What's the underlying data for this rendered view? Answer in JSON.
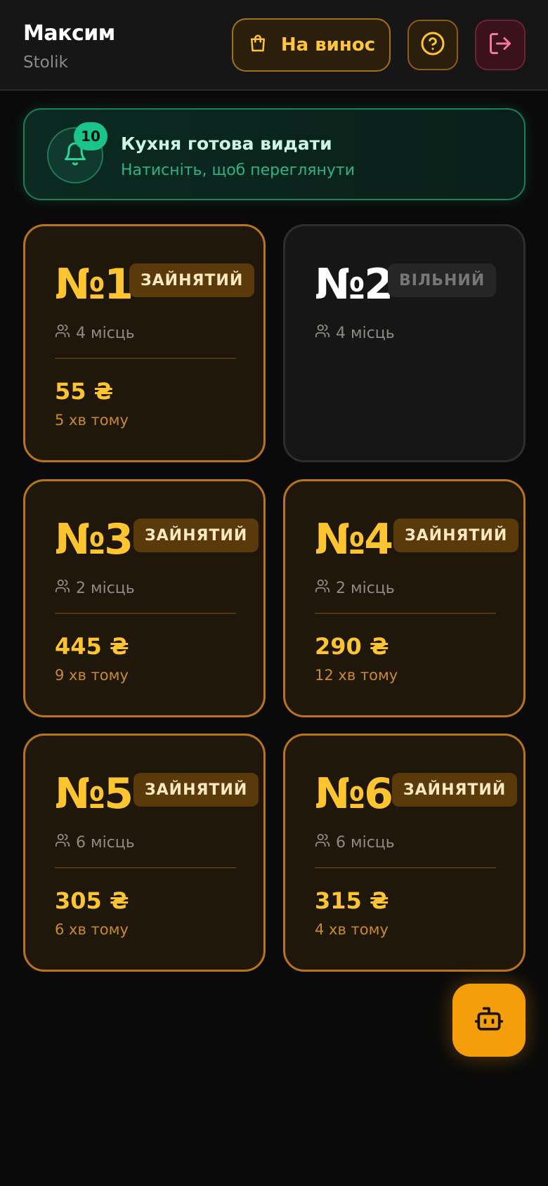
{
  "header": {
    "user_name": "Максим",
    "app_name": "Stolik",
    "takeaway_label": "На винос",
    "takeaway_icon": "shopping-bag-icon",
    "help_icon": "help-circle-icon",
    "logout_icon": "logout-icon"
  },
  "notification": {
    "count": "10",
    "title": "Кухня готова видати",
    "subtitle": "Натисніть, щоб переглянути",
    "icon": "bell-icon"
  },
  "tables": [
    {
      "number": "№1",
      "status": "ЗАЙНЯТИЙ",
      "seats": "4 місць",
      "amount": "55 ₴",
      "time": "5 хв тому",
      "occupied": true
    },
    {
      "number": "№2",
      "status": "ВІЛЬНИЙ",
      "seats": "4 місць",
      "amount": "",
      "time": "",
      "occupied": false
    },
    {
      "number": "№3",
      "status": "ЗАЙНЯТИЙ",
      "seats": "2 місць",
      "amount": "445 ₴",
      "time": "9 хв тому",
      "occupied": true
    },
    {
      "number": "№4",
      "status": "ЗАЙНЯТИЙ",
      "seats": "2 місць",
      "amount": "290 ₴",
      "time": "12 хв тому",
      "occupied": true
    },
    {
      "number": "№5",
      "status": "ЗАЙНЯТИЙ",
      "seats": "6 місць",
      "amount": "305 ₴",
      "time": "6 хв тому",
      "occupied": true
    },
    {
      "number": "№6",
      "status": "ЗАЙНЯТИЙ",
      "seats": "6 місць",
      "amount": "315 ₴",
      "time": "4 хв тому",
      "occupied": true
    }
  ],
  "fab": {
    "icon": "bot-icon"
  },
  "colors": {
    "accent": "#ffc531",
    "occupied_border": "#b8731d",
    "success": "#19c58a",
    "fab": "#f59e0b"
  }
}
